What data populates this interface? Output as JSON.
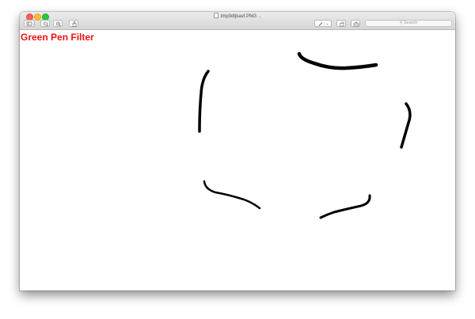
{
  "window": {
    "title": "tmp0dtjkavf.PNG"
  },
  "toolbar": {
    "search_placeholder": "Search"
  },
  "image": {
    "label": "Green Pen Filter",
    "label_color": "#ee1111",
    "stroke_color": "#000000"
  },
  "colors": {
    "close": "#fe5f57",
    "minimize": "#febc2e",
    "zoom": "#28c840"
  },
  "icons": [
    "sidebar-icon",
    "zoom-out-icon",
    "zoom-in-icon",
    "share-icon",
    "markup-pen-icon",
    "rotate-icon",
    "toolbox-icon",
    "search-icon"
  ]
}
